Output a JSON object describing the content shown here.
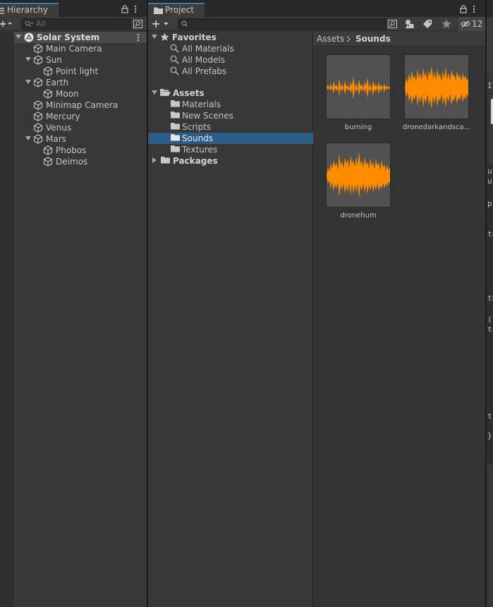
{
  "hierarchy": {
    "tab_label": "Hierarchy",
    "search_placeholder": "All",
    "scene_name": "Solar System",
    "items": [
      {
        "label": "Main Camera"
      },
      {
        "label": "Sun"
      },
      {
        "label": "Point light"
      },
      {
        "label": "Earth"
      },
      {
        "label": "Moon"
      },
      {
        "label": "Minimap Camera"
      },
      {
        "label": "Mercury"
      },
      {
        "label": "Venus"
      },
      {
        "label": "Mars"
      },
      {
        "label": "Phobos"
      },
      {
        "label": "Deimos"
      }
    ]
  },
  "project": {
    "tab_label": "Project",
    "hidden_count": "12",
    "favorites": {
      "label": "Favorites",
      "items": [
        {
          "label": "All Materials"
        },
        {
          "label": "All Models"
        },
        {
          "label": "All Prefabs"
        }
      ]
    },
    "assets": {
      "label": "Assets",
      "folders": [
        {
          "label": "Materials"
        },
        {
          "label": "New Scenes"
        },
        {
          "label": "Scripts"
        },
        {
          "label": "Sounds"
        },
        {
          "label": "Textures"
        }
      ]
    },
    "packages_label": "Packages",
    "breadcrumb": {
      "root": "Assets",
      "current": "Sounds"
    },
    "files": [
      {
        "label": "burning"
      },
      {
        "label": "dronedarkandsca..."
      },
      {
        "label": "dronehum"
      }
    ]
  },
  "inspector": {
    "fragments": [
      "Ir",
      "u",
      "u",
      "p",
      "ta",
      "th",
      "(\"",
      "tc",
      "tr",
      "}"
    ]
  },
  "colors": {
    "waveform": "#ff8c00",
    "selection": "#2c5d87",
    "tab_accent": "#3a79bb"
  }
}
